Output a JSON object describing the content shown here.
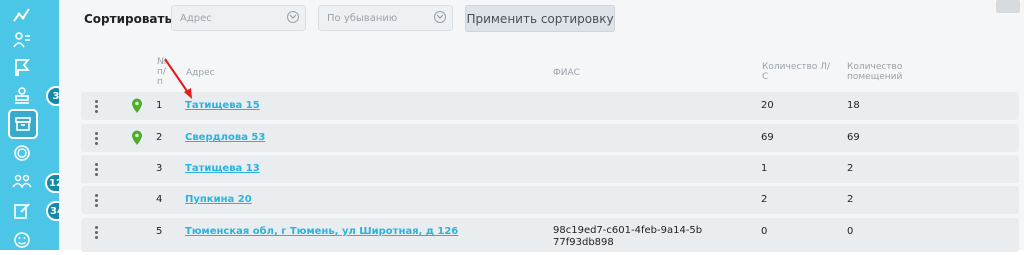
{
  "sidebar": {
    "items": [
      {
        "icon": "chart-icon"
      },
      {
        "icon": "users-list-icon"
      },
      {
        "icon": "flag-icon"
      },
      {
        "icon": "stamp-icon",
        "badge": "3"
      },
      {
        "icon": "archive-icon",
        "active": true
      },
      {
        "icon": "coin-icon"
      },
      {
        "icon": "group-icon",
        "badge": "129"
      },
      {
        "icon": "edit-icon",
        "badge": "34"
      },
      {
        "icon": "smiley-icon"
      }
    ]
  },
  "toolbar": {
    "sort_label": "Сортировать",
    "address_placeholder": "Адрес",
    "order_value": "По убыванию",
    "apply_label": "Применить сортировку"
  },
  "table": {
    "headers": {
      "num": [
        "№",
        "п/",
        "п"
      ],
      "address": "Адрес",
      "fias": "ФИАС",
      "accounts": [
        "Количество Л/",
        "С"
      ],
      "rooms": [
        "Количество",
        "помещений"
      ]
    },
    "rows": [
      {
        "num": "1",
        "address": "Татищева 15",
        "fias": "",
        "accounts": "20",
        "rooms": "18",
        "pin": true
      },
      {
        "num": "2",
        "address": "Свердлова 53",
        "fias": "",
        "accounts": "69",
        "rooms": "69",
        "pin": true
      },
      {
        "num": "3",
        "address": "Татищева 13",
        "fias": "",
        "accounts": "1",
        "rooms": "2",
        "pin": false
      },
      {
        "num": "4",
        "address": "Пупкина 20",
        "fias": "",
        "accounts": "2",
        "rooms": "2",
        "pin": false
      },
      {
        "num": "5",
        "address": "Тюменская обл, г Тюмень, ул Широтная, д 126",
        "fias": "98c19ed7-c601-4feb-9a14-5b77f93db898",
        "accounts": "0",
        "rooms": "0",
        "pin": false
      }
    ]
  },
  "colors": {
    "sidebar": "#4cc6e6",
    "link": "#2bb3dc",
    "pin": "#4caf2a",
    "arrow": "#e21b1b"
  }
}
